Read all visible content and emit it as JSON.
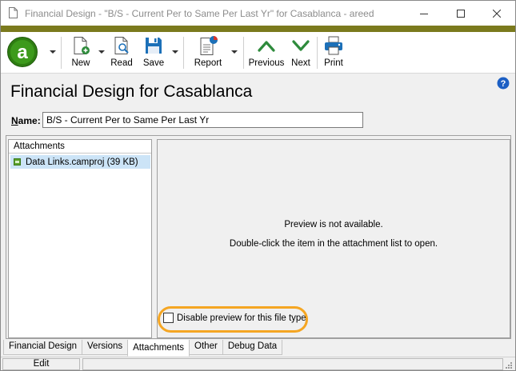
{
  "window": {
    "title": "Financial Design - \"B/S - Current Per to Same Per Last Yr\" for Casablanca - areed"
  },
  "toolbar": {
    "new_label": "New",
    "read_label": "Read",
    "save_label": "Save",
    "report_label": "Report",
    "previous_label": "Previous",
    "next_label": "Next",
    "print_label": "Print"
  },
  "header": {
    "title": "Financial Design for Casablanca"
  },
  "name_field": {
    "label": "Name:",
    "value": "B/S - Current Per to Same Per Last Yr"
  },
  "attachments": {
    "header": "Attachments",
    "items": [
      {
        "label": "Data Links.camproj (39 KB)"
      }
    ]
  },
  "preview": {
    "message": "Preview is not available.",
    "hint": "Double-click the item in the attachment list to open.",
    "disable_label": "Disable preview for this file type",
    "disable_checked": false
  },
  "tabs": [
    {
      "label": "Financial Design",
      "active": false
    },
    {
      "label": "Versions",
      "active": false
    },
    {
      "label": "Attachments",
      "active": true
    },
    {
      "label": "Other",
      "active": false
    },
    {
      "label": "Debug Data",
      "active": false
    }
  ],
  "status": {
    "mode": "Edit"
  },
  "colors": {
    "accent_bar": "#7b7a1d",
    "logo_green": "#2e7d12",
    "arrow_green": "#2e8b3c",
    "save_blue": "#1c70b8",
    "highlight": "#f5a623",
    "selection": "#cce4f7"
  }
}
